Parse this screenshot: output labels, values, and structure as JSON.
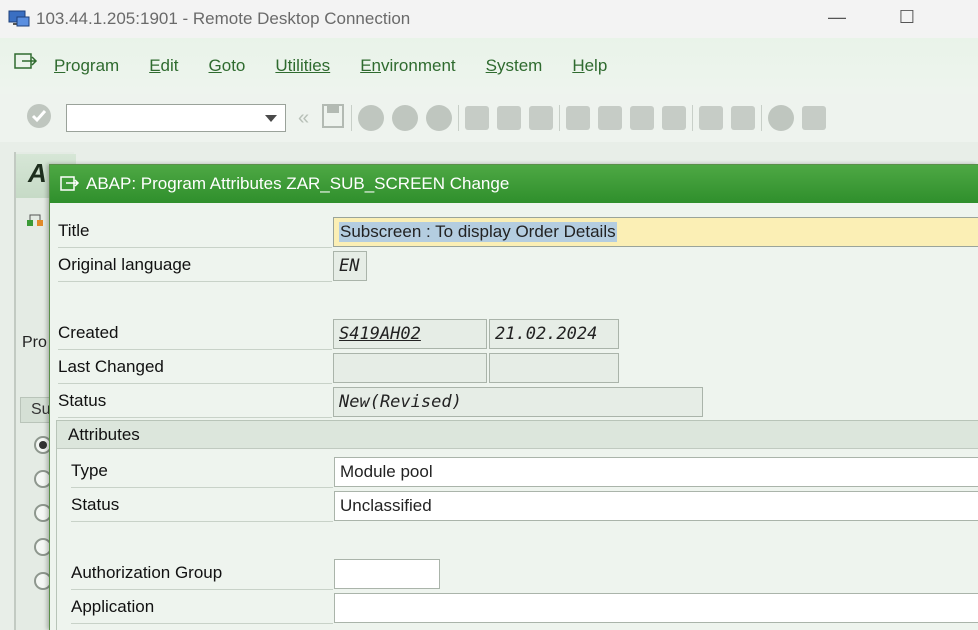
{
  "window": {
    "title": "103.44.1.205:1901 - Remote Desktop Connection",
    "minimize_glyph": "—",
    "maximize_glyph": "☐",
    "icon": "remote-desktop-icon"
  },
  "menubar": {
    "items": [
      {
        "underline": "P",
        "rest": "rogram"
      },
      {
        "underline": "E",
        "rest": "dit"
      },
      {
        "underline": "G",
        "rest": "oto"
      },
      {
        "underline": "Utilities",
        "rest": ""
      },
      {
        "underline": "En",
        "rest": "vironment"
      },
      {
        "underline": "S",
        "rest": "ystem"
      },
      {
        "underline": "H",
        "rest": "elp"
      }
    ]
  },
  "toolbar": {
    "command_field_value": "",
    "back_glyph": "«"
  },
  "background_screen": {
    "partial_title": "A",
    "partial_label": "Pro",
    "partial_tab": "Su"
  },
  "dialog": {
    "title": "ABAP: Program Attributes ZAR_SUB_SCREEN Change",
    "fields": {
      "title_label": "Title",
      "title_value": "Subscreen  : To display Order Details",
      "language_label": "Original language",
      "language_value": "EN",
      "created_label": "Created",
      "created_by": "S419AH02",
      "created_date": "21.02.2024",
      "changed_label": "Last Changed",
      "changed_by": "",
      "changed_date": "",
      "status_label": "Status",
      "status_value": "New(Revised)"
    },
    "attributes": {
      "heading": "Attributes",
      "type_label": "Type",
      "type_value": "Module pool",
      "status_label": "Status",
      "status_value": "Unclassified",
      "auth_label": "Authorization Group",
      "auth_value": "",
      "app_label": "Application",
      "app_value": ""
    }
  },
  "colors": {
    "dialog_title_bg": "#3a9a36",
    "menu_text": "#2f6b2f",
    "title_field_bg": "#fbefb5",
    "selection": "#b4cde0"
  }
}
